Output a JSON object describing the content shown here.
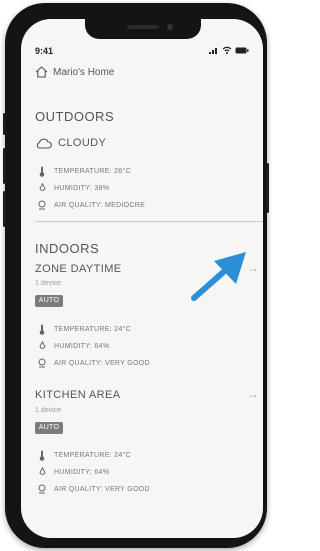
{
  "status_bar": {
    "time": "9:41"
  },
  "header": {
    "home_label": "Mario's Home"
  },
  "outdoors": {
    "title": "OUTDOORS",
    "condition": "CLOUDY",
    "metrics": {
      "temperature": "TEMPERATURE: 26°C",
      "humidity": "HUMIDITY: 38%",
      "air_quality": "AIR QUALITY: MEDIOCRE"
    }
  },
  "indoors": {
    "title": "INDOORS",
    "zones": [
      {
        "name": "ZONE DAYTIME",
        "devices": "1 device",
        "mode": "AUTO",
        "temperature": "TEMPERATURE: 24°C",
        "humidity": "HUMIDITY: 64%",
        "air_quality": "AIR QUALITY: VERY GOOD"
      },
      {
        "name": "KITCHEN AREA",
        "devices": "1 device",
        "mode": "AUTO",
        "temperature": "TEMPERATURE: 24°C",
        "humidity": "HUMIDITY: 64%",
        "air_quality": "AIR QUALITY: VERY GOOD"
      }
    ]
  },
  "icons": {
    "home": "home-icon",
    "cloud": "cloud-icon",
    "thermometer": "thermometer-icon",
    "humidity": "water-drop-icon",
    "air_quality": "air-quality-icon",
    "chevron": "arrow-right-icon",
    "pointer": "pointer-arrow-icon"
  },
  "colors": {
    "pointer": "#2a8fd6",
    "badge": "#7c7c7c",
    "phone_frame": "#141414"
  }
}
